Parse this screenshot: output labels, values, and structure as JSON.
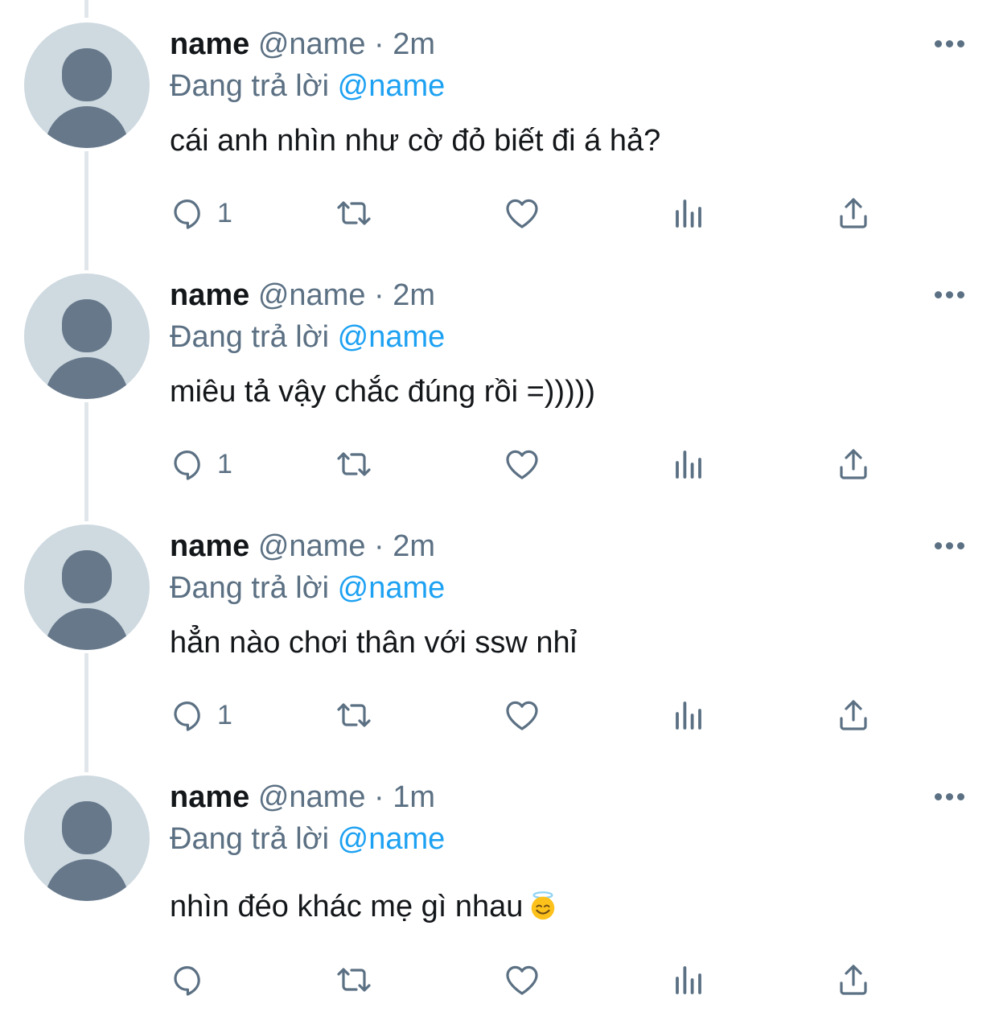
{
  "reply_prefix": "Đang trả lời",
  "colors": {
    "accent": "#1da1f2",
    "secondary_text": "#5b7083",
    "avatar_bg": "#ced9e0",
    "avatar_fg": "#66788a"
  },
  "icons": [
    "reply-icon",
    "retweet-icon",
    "like-icon",
    "analytics-icon",
    "share-icon",
    "more-icon",
    "halo-smile-emoji-icon"
  ],
  "tweets": [
    {
      "display_name": "name",
      "handle": "@name",
      "separator": "·",
      "time": "2m",
      "replying_to": "@name",
      "text": "cái anh nhìn như cờ đỏ biết đi á hả?",
      "reply_count": "1"
    },
    {
      "display_name": "name",
      "handle": "@name",
      "separator": "·",
      "time": "2m",
      "replying_to": "@name",
      "text": "miêu tả vậy chắc đúng rồi =)))))",
      "reply_count": "1"
    },
    {
      "display_name": "name",
      "handle": "@name",
      "separator": "·",
      "time": "2m",
      "replying_to": "@name",
      "text": "hẳn nào chơi thân với ssw nhỉ",
      "reply_count": "1"
    },
    {
      "display_name": "name",
      "handle": "@name",
      "separator": "·",
      "time": "1m",
      "replying_to": "@name",
      "text": "nhìn đéo khác mẹ gì nhau",
      "reply_count": ""
    }
  ]
}
